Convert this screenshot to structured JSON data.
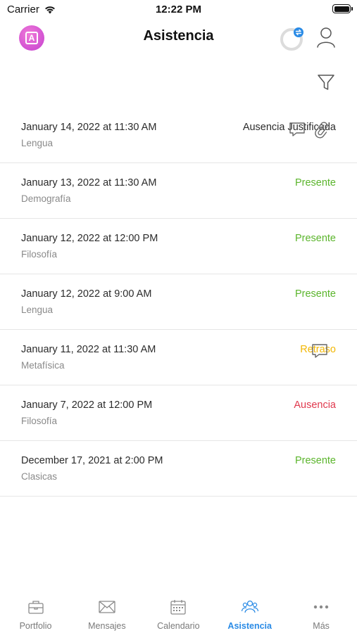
{
  "status_bar": {
    "carrier": "Carrier",
    "time": "12:22 PM"
  },
  "header": {
    "title": "Asistencia",
    "logo_letter": "A"
  },
  "colors": {
    "present": "#5bb52c",
    "late": "#f2b705",
    "absent": "#e0384d",
    "justified": "#2b2b2b",
    "accent": "#2a8be6"
  },
  "records": [
    {
      "date": "January 14, 2022 at 11:30 AM",
      "subject": "Lengua",
      "status": "Ausencia Justificada",
      "status_type": "justified",
      "comment": true,
      "attachment": true
    },
    {
      "date": "January 13, 2022 at 11:30 AM",
      "subject": "Demografía",
      "status": "Presente",
      "status_type": "present",
      "comment": false,
      "attachment": false
    },
    {
      "date": "January 12, 2022 at 12:00 PM",
      "subject": "Filosofía",
      "status": "Presente",
      "status_type": "present",
      "comment": false,
      "attachment": false
    },
    {
      "date": "January 12, 2022 at 9:00 AM",
      "subject": "Lengua",
      "status": "Presente",
      "status_type": "present",
      "comment": false,
      "attachment": false
    },
    {
      "date": "January 11, 2022 at 11:30 AM",
      "subject": "Metafísica",
      "status": "Retraso",
      "status_type": "late",
      "comment": true,
      "attachment": false
    },
    {
      "date": "January 7, 2022 at 12:00 PM",
      "subject": "Filosofía",
      "status": "Ausencia",
      "status_type": "absent",
      "comment": false,
      "attachment": false
    },
    {
      "date": "December 17, 2021 at 2:00 PM",
      "subject": "Clasicas",
      "status": "Presente",
      "status_type": "present",
      "comment": false,
      "attachment": false
    }
  ],
  "tabs": [
    {
      "label": "Portfolio",
      "icon": "briefcase-icon",
      "active": false
    },
    {
      "label": "Mensajes",
      "icon": "envelope-icon",
      "active": false
    },
    {
      "label": "Calendario",
      "icon": "calendar-icon",
      "active": false
    },
    {
      "label": "Asistencia",
      "icon": "people-icon",
      "active": true
    },
    {
      "label": "Más",
      "icon": "more-dots-icon",
      "active": false
    }
  ]
}
